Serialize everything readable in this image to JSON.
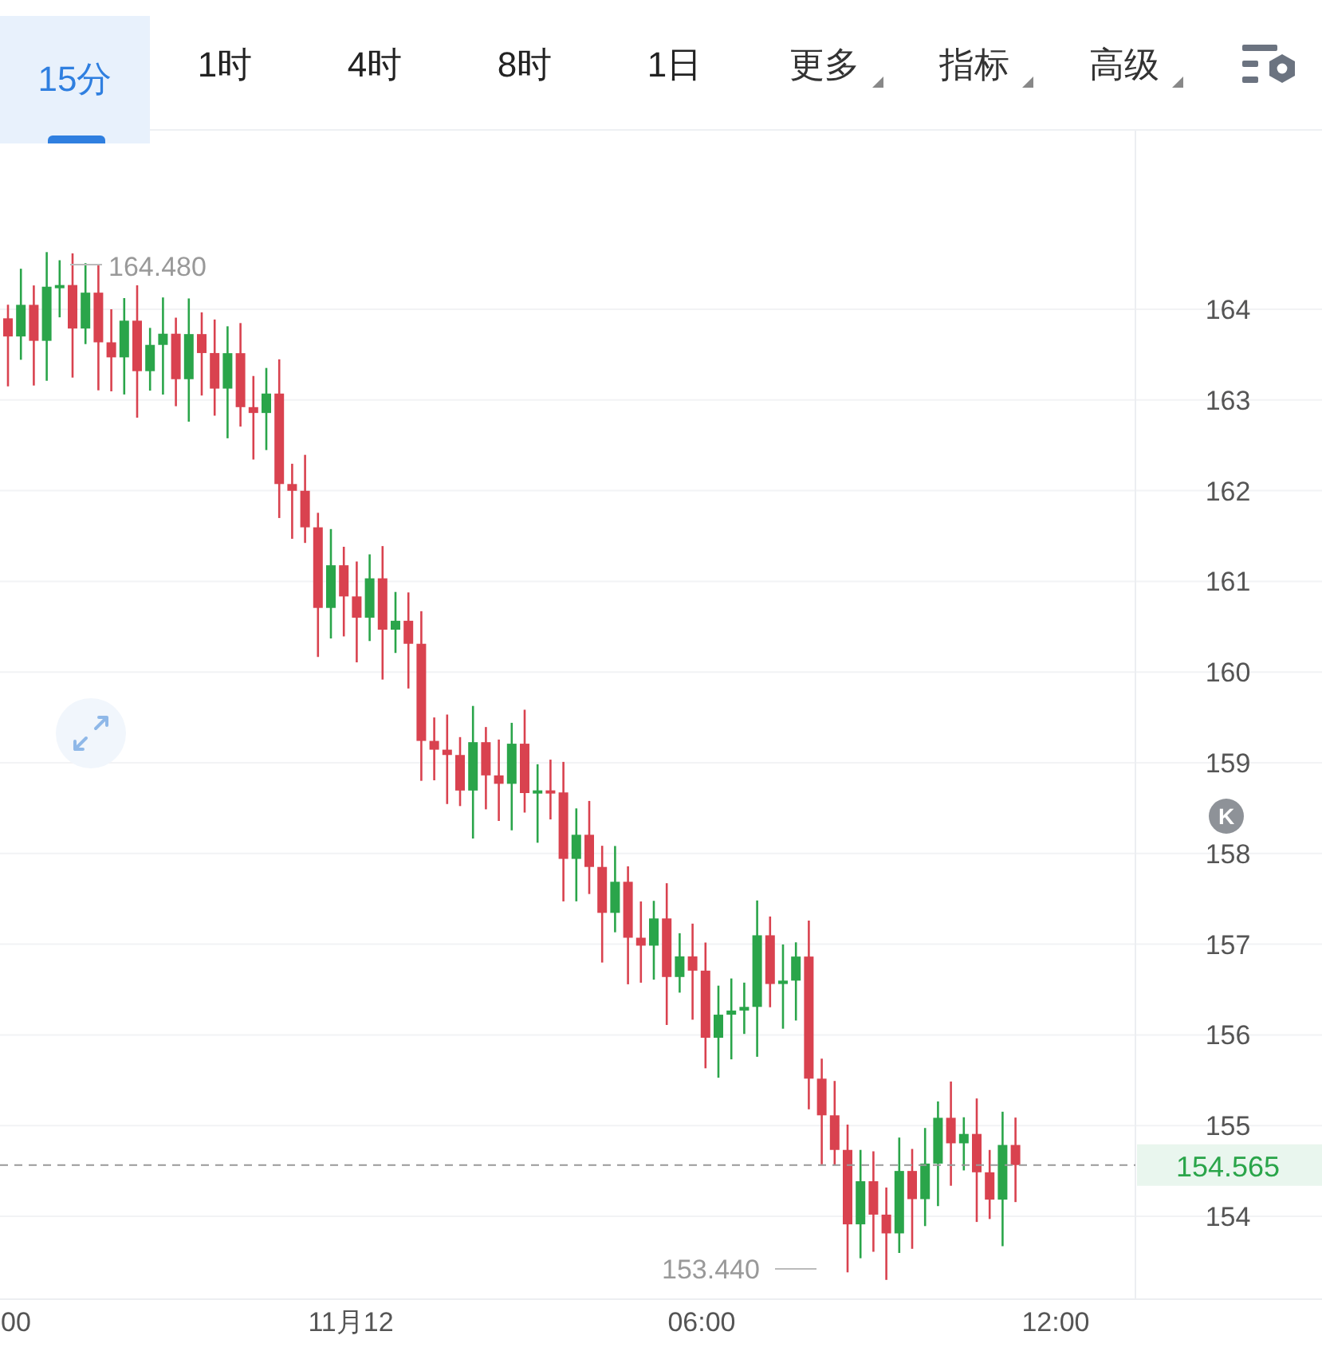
{
  "tabs": [
    {
      "label": "15分",
      "selected": true,
      "kind": "plain"
    },
    {
      "label": "1时",
      "selected": false,
      "kind": "plain"
    },
    {
      "label": "4时",
      "selected": false,
      "kind": "plain"
    },
    {
      "label": "8时",
      "selected": false,
      "kind": "plain"
    },
    {
      "label": "1日",
      "selected": false,
      "kind": "plain"
    },
    {
      "label": "更多",
      "selected": false,
      "kind": "dropdown"
    },
    {
      "label": "指标",
      "selected": false,
      "kind": "dropdown"
    },
    {
      "label": "高级",
      "selected": false,
      "kind": "dropdown"
    }
  ],
  "chart": {
    "y_axis": [
      "164",
      "163",
      "162",
      "161",
      "160",
      "159",
      "158",
      "157",
      "156",
      "155",
      "154"
    ],
    "x_axis": [
      "00",
      "11月12",
      "06:00",
      "12:00"
    ],
    "high_marker": "164.480",
    "low_marker": "153.440",
    "last_price": "154.565",
    "badge": "K"
  }
}
